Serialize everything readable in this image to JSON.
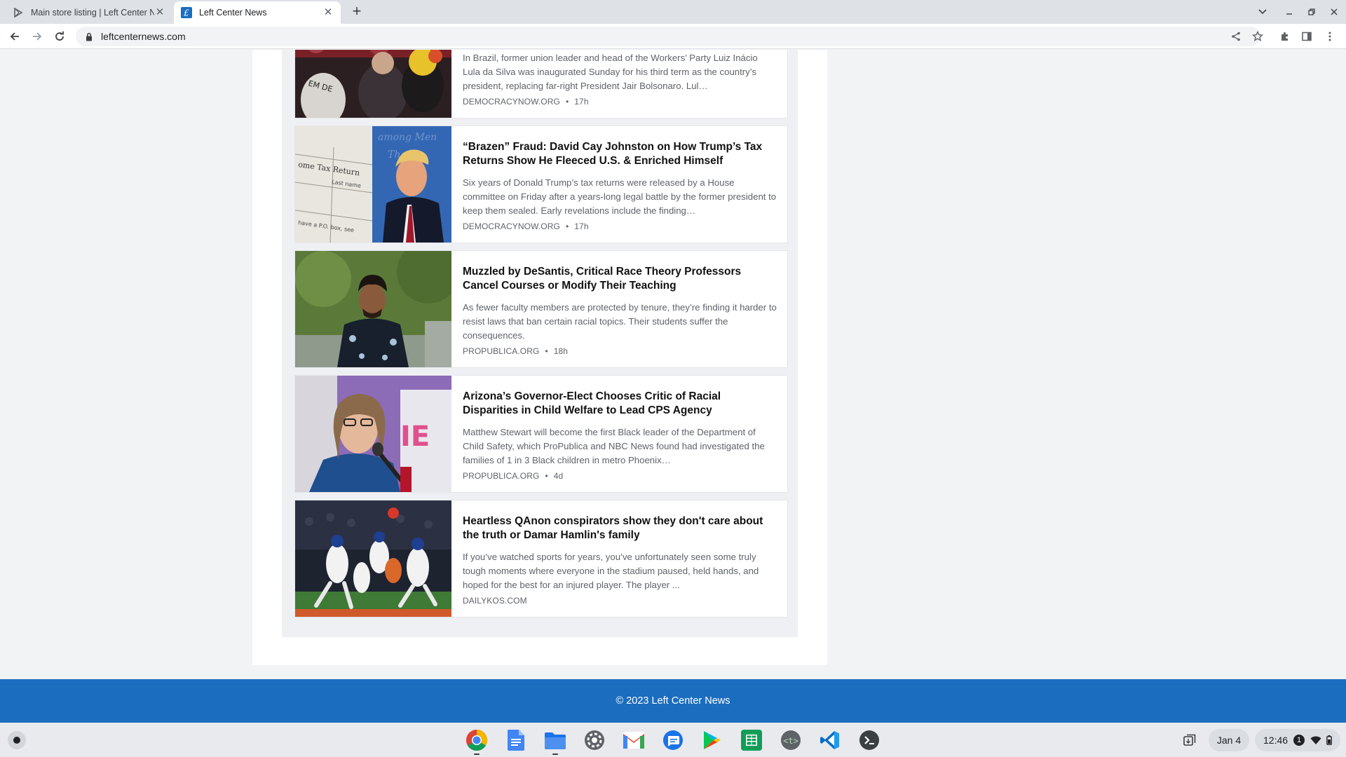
{
  "browser": {
    "tabs": [
      {
        "title": "Main store listing | Left Center News",
        "active": false,
        "icon": "play-console-icon"
      },
      {
        "title": "Left Center News",
        "active": true,
        "icon": "lcn-favicon"
      }
    ],
    "url": "leftcenternews.com"
  },
  "articles": [
    {
      "title": "",
      "excerpt": "In Brazil, former union leader and head of the Workers’ Party Luiz Inácio Lula da Silva was inaugurated Sunday for his third term as the country’s president, replacing far-right President Jair Bolsonaro. Lul…",
      "source": "DEMOCRACYNOW.ORG",
      "time": "17h"
    },
    {
      "title": "“Brazen” Fraud: David Cay Johnston on How Trump’s Tax Returns Show He Fleeced U.S. & Enriched Himself",
      "excerpt": "Six years of Donald Trump’s tax returns were released by a House committee on Friday after a years-long legal battle by the former president to keep them sealed. Early revelations include the finding…",
      "source": "DEMOCRACYNOW.ORG",
      "time": "17h"
    },
    {
      "title": "Muzzled by DeSantis, Critical Race Theory Professors Cancel Courses or Modify Their Teaching",
      "excerpt": "As fewer faculty members are protected by tenure, they’re finding it harder to resist laws that ban certain racial topics. Their students suffer the consequences.",
      "source": "PROPUBLICA.ORG",
      "time": "18h"
    },
    {
      "title": "Arizona’s Governor-Elect Chooses Critic of Racial Disparities in Child Welfare to Lead CPS Agency",
      "excerpt": "Matthew Stewart will become the first Black leader of the Department of Child Safety, which ProPublica and NBC News found had investigated the families of 1 in 3 Black children in metro Phoenix…",
      "source": "PROPUBLICA.ORG",
      "time": "4d"
    },
    {
      "title": "Heartless QAnon conspirators show they don't care about the truth or Damar Hamlin's family",
      "excerpt": "If you’ve watched sports for years, you’ve unfortunately seen some truly tough moments where everyone in the stadium paused, held hands, and hoped for the best for an injured player. The player ...",
      "source": "DAILYKOS.COM",
      "time": ""
    }
  ],
  "footer": {
    "text": "© 2023 Left Center News"
  },
  "shelf": {
    "apps": [
      "chrome-icon",
      "docs-icon",
      "files-icon",
      "settings-icon",
      "gmail-icon",
      "messages-icon",
      "play-store-icon",
      "sheets-icon",
      "text-editor-icon",
      "vscode-icon",
      "terminal-icon"
    ],
    "date": "Jan 4",
    "time": "12:46",
    "notification_count": "1"
  },
  "colors": {
    "footer": "#1b6dbf",
    "headline": "#111111",
    "muted": "#5f6368"
  }
}
